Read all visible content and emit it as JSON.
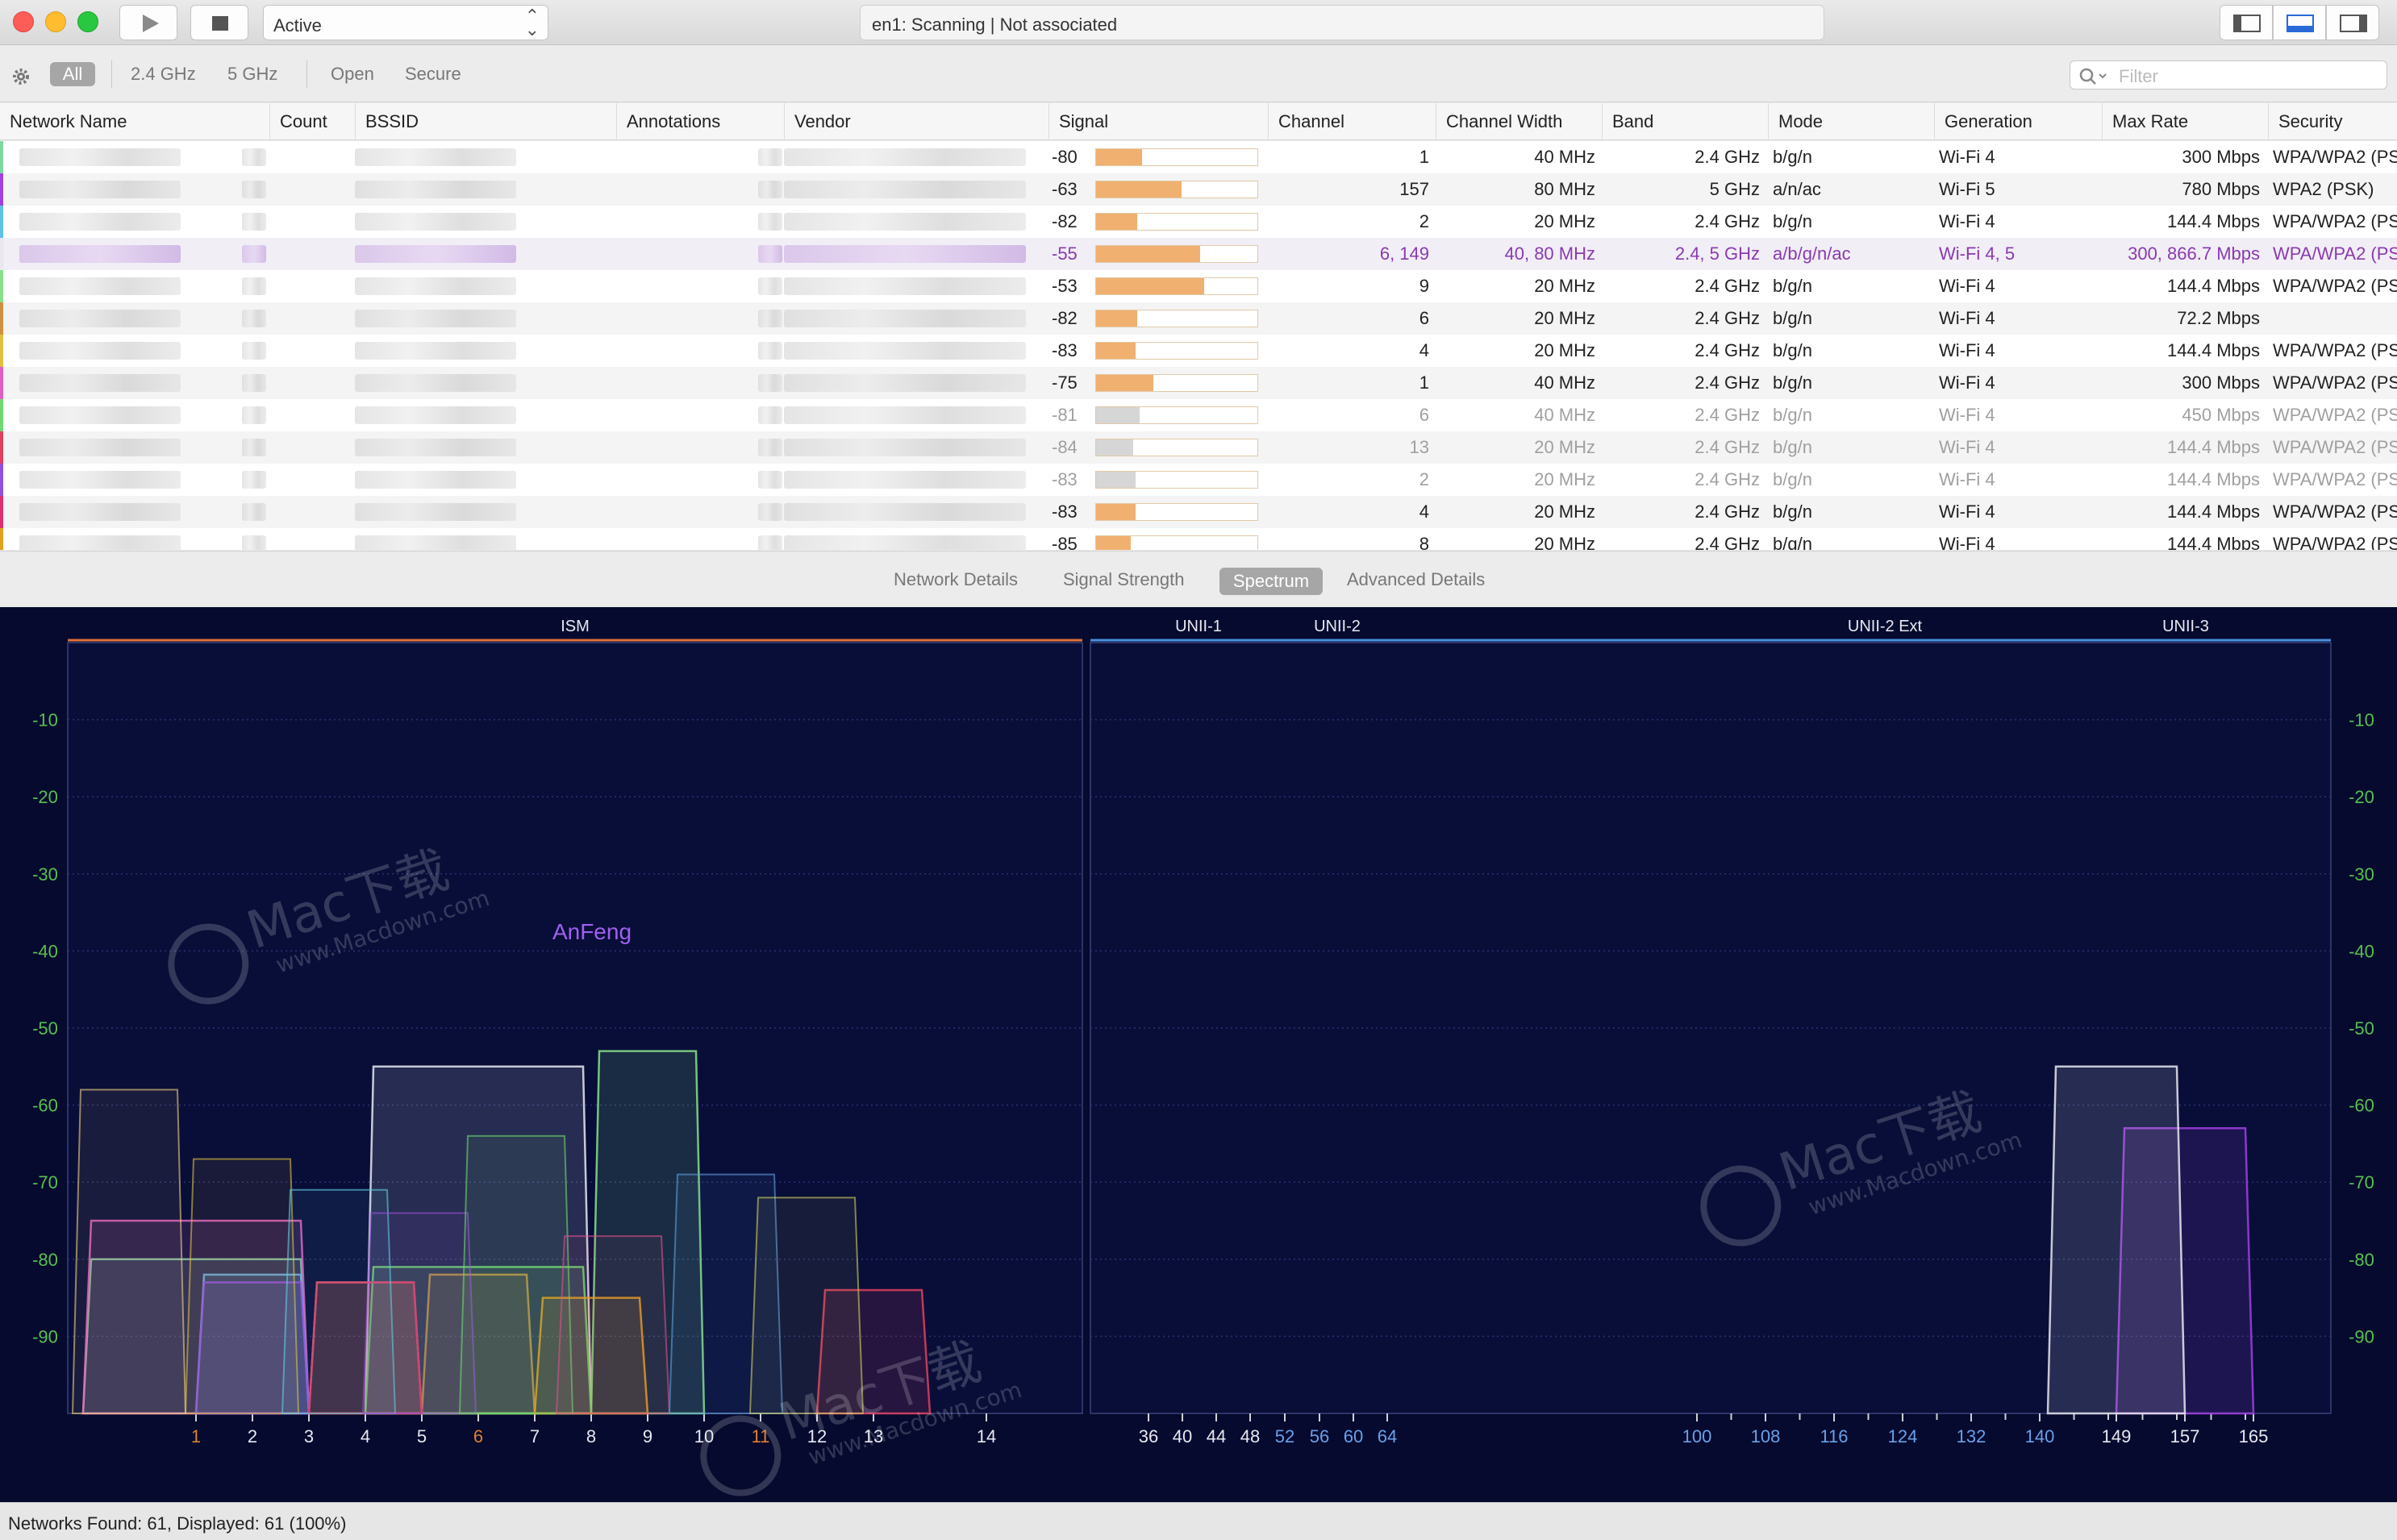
{
  "toolbar": {
    "scan_state": "Active",
    "status_text": "en1: Scanning  |  Not associated",
    "play_icon": "play-icon",
    "stop_icon": "stop-icon"
  },
  "filters": {
    "items": [
      "All",
      "2.4 GHz",
      "5 GHz",
      "Open",
      "Secure"
    ],
    "active": "All",
    "placeholder": "Filter"
  },
  "table": {
    "columns": [
      "Network Name",
      "Count",
      "BSSID",
      "Annotations",
      "Vendor",
      "Signal",
      "Channel",
      "Channel Width",
      "Band",
      "Mode",
      "Generation",
      "Max Rate",
      "Security"
    ],
    "rows": [
      {
        "signal": -80,
        "channel": "1",
        "width": "40 MHz",
        "band": "2.4 GHz",
        "mode": "b/g/n",
        "gen": "Wi-Fi 4",
        "rate": "300 Mbps",
        "security": "WPA/WPA2 (PS",
        "color": "#7fd8a0",
        "dim": false,
        "highlight": false
      },
      {
        "signal": -63,
        "channel": "157",
        "width": "80 MHz",
        "band": "5 GHz",
        "mode": "a/n/ac",
        "gen": "Wi-Fi 5",
        "rate": "780 Mbps",
        "security": "WPA2 (PSK)",
        "color": "#a040e0",
        "dim": false,
        "highlight": false
      },
      {
        "signal": -82,
        "channel": "2",
        "width": "20 MHz",
        "band": "2.4 GHz",
        "mode": "b/g/n",
        "gen": "Wi-Fi 4",
        "rate": "144.4 Mbps",
        "security": "WPA/WPA2 (PS",
        "color": "#5fc0e8",
        "dim": false,
        "highlight": false
      },
      {
        "signal": -55,
        "channel": "6, 149",
        "width": "40, 80 MHz",
        "band": "2.4, 5 GHz",
        "mode": "a/b/g/n/ac",
        "gen": "Wi-Fi 4, 5",
        "rate": "300, 866.7 Mbps",
        "security": "WPA/WPA2 (PS",
        "color": "#e8e8ee",
        "dim": false,
        "highlight": true
      },
      {
        "signal": -53,
        "channel": "9",
        "width": "20 MHz",
        "band": "2.4 GHz",
        "mode": "b/g/n",
        "gen": "Wi-Fi 4",
        "rate": "144.4 Mbps",
        "security": "WPA/WPA2 (PS",
        "color": "#8ae08a",
        "dim": false,
        "highlight": false
      },
      {
        "signal": -82,
        "channel": "6",
        "width": "20 MHz",
        "band": "2.4 GHz",
        "mode": "b/g/n",
        "gen": "Wi-Fi 4",
        "rate": "72.2 Mbps",
        "security": "",
        "color": "#d09040",
        "dim": false,
        "highlight": false
      },
      {
        "signal": -83,
        "channel": "4",
        "width": "20 MHz",
        "band": "2.4 GHz",
        "mode": "b/g/n",
        "gen": "Wi-Fi 4",
        "rate": "144.4 Mbps",
        "security": "WPA/WPA2 (PS",
        "color": "#e0c040",
        "dim": false,
        "highlight": false
      },
      {
        "signal": -75,
        "channel": "1",
        "width": "40 MHz",
        "band": "2.4 GHz",
        "mode": "b/g/n",
        "gen": "Wi-Fi 4",
        "rate": "300 Mbps",
        "security": "WPA/WPA2 (PS",
        "color": "#e060c0",
        "dim": false,
        "highlight": false
      },
      {
        "signal": -81,
        "channel": "6",
        "width": "40 MHz",
        "band": "2.4 GHz",
        "mode": "b/g/n",
        "gen": "Wi-Fi 4",
        "rate": "450 Mbps",
        "security": "WPA/WPA2 (PS",
        "color": "#70d870",
        "dim": true,
        "highlight": false
      },
      {
        "signal": -84,
        "channel": "13",
        "width": "20 MHz",
        "band": "2.4 GHz",
        "mode": "b/g/n",
        "gen": "Wi-Fi 4",
        "rate": "144.4 Mbps",
        "security": "WPA/WPA2 (PS",
        "color": "#e04060",
        "dim": true,
        "highlight": false
      },
      {
        "signal": -83,
        "channel": "2",
        "width": "20 MHz",
        "band": "2.4 GHz",
        "mode": "b/g/n",
        "gen": "Wi-Fi 4",
        "rate": "144.4 Mbps",
        "security": "WPA/WPA2 (PS",
        "color": "#9050e0",
        "dim": true,
        "highlight": false
      },
      {
        "signal": -83,
        "channel": "4",
        "width": "20 MHz",
        "band": "2.4 GHz",
        "mode": "b/g/n",
        "gen": "Wi-Fi 4",
        "rate": "144.4 Mbps",
        "security": "WPA/WPA2 (PS",
        "color": "#e03070",
        "dim": false,
        "highlight": false
      },
      {
        "signal": -85,
        "channel": "8",
        "width": "20 MHz",
        "band": "2.4 GHz",
        "mode": "b/g/n",
        "gen": "Wi-Fi 4",
        "rate": "144.4 Mbps",
        "security": "WPA/WPA2 (PS",
        "color": "#e0a020",
        "dim": false,
        "highlight": false
      }
    ]
  },
  "tabs": {
    "items": [
      "Network Details",
      "Signal Strength",
      "Spectrum",
      "Advanced Details"
    ],
    "active": "Spectrum"
  },
  "spectrum": {
    "band_labels": {
      "ism": "ISM",
      "unii1": "UNII-1",
      "unii2": "UNII-2",
      "unii2ext": "UNII-2 Ext",
      "unii3": "UNII-3"
    },
    "y_ticks": [
      -10,
      -20,
      -30,
      -40,
      -50,
      -60,
      -70,
      -80,
      -90
    ],
    "ylim": [
      0,
      -100
    ],
    "ism_channels": [
      {
        "label": "1",
        "highlight": true
      },
      {
        "label": "2",
        "highlight": false
      },
      {
        "label": "3",
        "highlight": false
      },
      {
        "label": "4",
        "highlight": false
      },
      {
        "label": "5",
        "highlight": false
      },
      {
        "label": "6",
        "highlight": true
      },
      {
        "label": "7",
        "highlight": false
      },
      {
        "label": "8",
        "highlight": false
      },
      {
        "label": "9",
        "highlight": false
      },
      {
        "label": "10",
        "highlight": false
      },
      {
        "label": "11",
        "highlight": true
      },
      {
        "label": "12",
        "highlight": false
      },
      {
        "label": "13",
        "highlight": false
      },
      {
        "label": "14",
        "highlight": false
      }
    ],
    "unii_channels": [
      {
        "label": "36",
        "group": "unii1"
      },
      {
        "label": "40",
        "group": "unii1"
      },
      {
        "label": "44",
        "group": "unii1"
      },
      {
        "label": "48",
        "group": "unii1"
      },
      {
        "label": "52",
        "group": "unii2"
      },
      {
        "label": "56",
        "group": "unii2"
      },
      {
        "label": "60",
        "group": "unii2"
      },
      {
        "label": "64",
        "group": "unii2"
      },
      {
        "label": "100",
        "group": "unii2ext"
      },
      {
        "label": "108",
        "group": "unii2ext"
      },
      {
        "label": "116",
        "group": "unii2ext"
      },
      {
        "label": "124",
        "group": "unii2ext"
      },
      {
        "label": "132",
        "group": "unii2ext"
      },
      {
        "label": "140",
        "group": "unii2ext"
      },
      {
        "label": "149",
        "group": "unii3"
      },
      {
        "label": "157",
        "group": "unii3"
      },
      {
        "label": "165",
        "group": "unii3"
      }
    ],
    "network_label": "AnFeng",
    "colors": {
      "background": "#050a2e",
      "ism": "#e0703a",
      "unii": "#4a90e0",
      "grid": "#2a3470",
      "tick_green": "#56c050",
      "channel_highlight": "#e08030",
      "channel_blue": "#6aa0e8"
    }
  },
  "watermark": {
    "brand": "Mac下载",
    "site": "www.Macdown.com"
  },
  "status": {
    "text": "Networks Found: 61, Displayed: 61 (100%)"
  }
}
